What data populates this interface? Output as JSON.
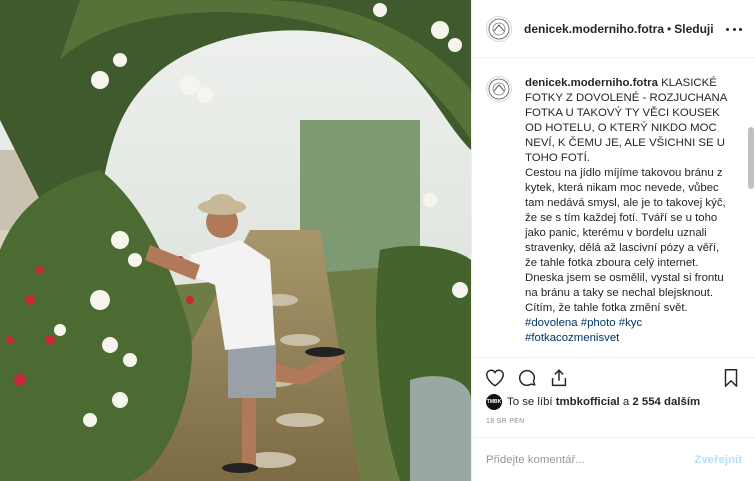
{
  "post": {
    "username": "denicek.moderniho.fotra",
    "separator": "•",
    "follow_label": "Sleduji",
    "caption": {
      "username": "denicek.moderniho.fotra",
      "lines": [
        " KLASICKÉ FOTKY Z DOVOLENÉ - ROZJUCHANA FOTKA U TAKOVÝ TY VĚCI KOUSEK OD HOTELU, O KTERÝ NIKDO MOC NEVÍ, K ČEMU JE, ALE VŠICHNI SE U TOHO FOTÍ.",
        "Cestou na jídlo míjíme takovou bránu z kytek, která nikam moc nevede, vůbec tam nedává smysl, ale je to takovej kýč, že se s tím každej fotí. Tváří se u toho jako panic, kterému v bordelu uznali stravenky, dělá až lascivní pózy a věří, že tahle fotka zboura celý internet.",
        "Dneska jsem se osmělil, vystal si frontu na bránu a taky se nechal blejsknout. Cítím, že tahle fotka změní svět."
      ],
      "hashtags": [
        "#dovolena",
        "#photo",
        "#kyc",
        "#fotkacozmenisvet"
      ]
    },
    "likes": {
      "avatar_text": "TMBK",
      "prefix": "To se líbí",
      "user": "tmbkofficial",
      "middle": "a",
      "count": "2 554 dalším"
    },
    "date": "18 SR PEN",
    "comment_placeholder": "Přidejte komentář...",
    "publish_label": "Zveřejnit"
  },
  "icons": {
    "more": "more-horizontal-icon",
    "like": "heart-icon",
    "comment": "comment-bubble-icon",
    "share": "share-icon",
    "save": "bookmark-icon"
  }
}
